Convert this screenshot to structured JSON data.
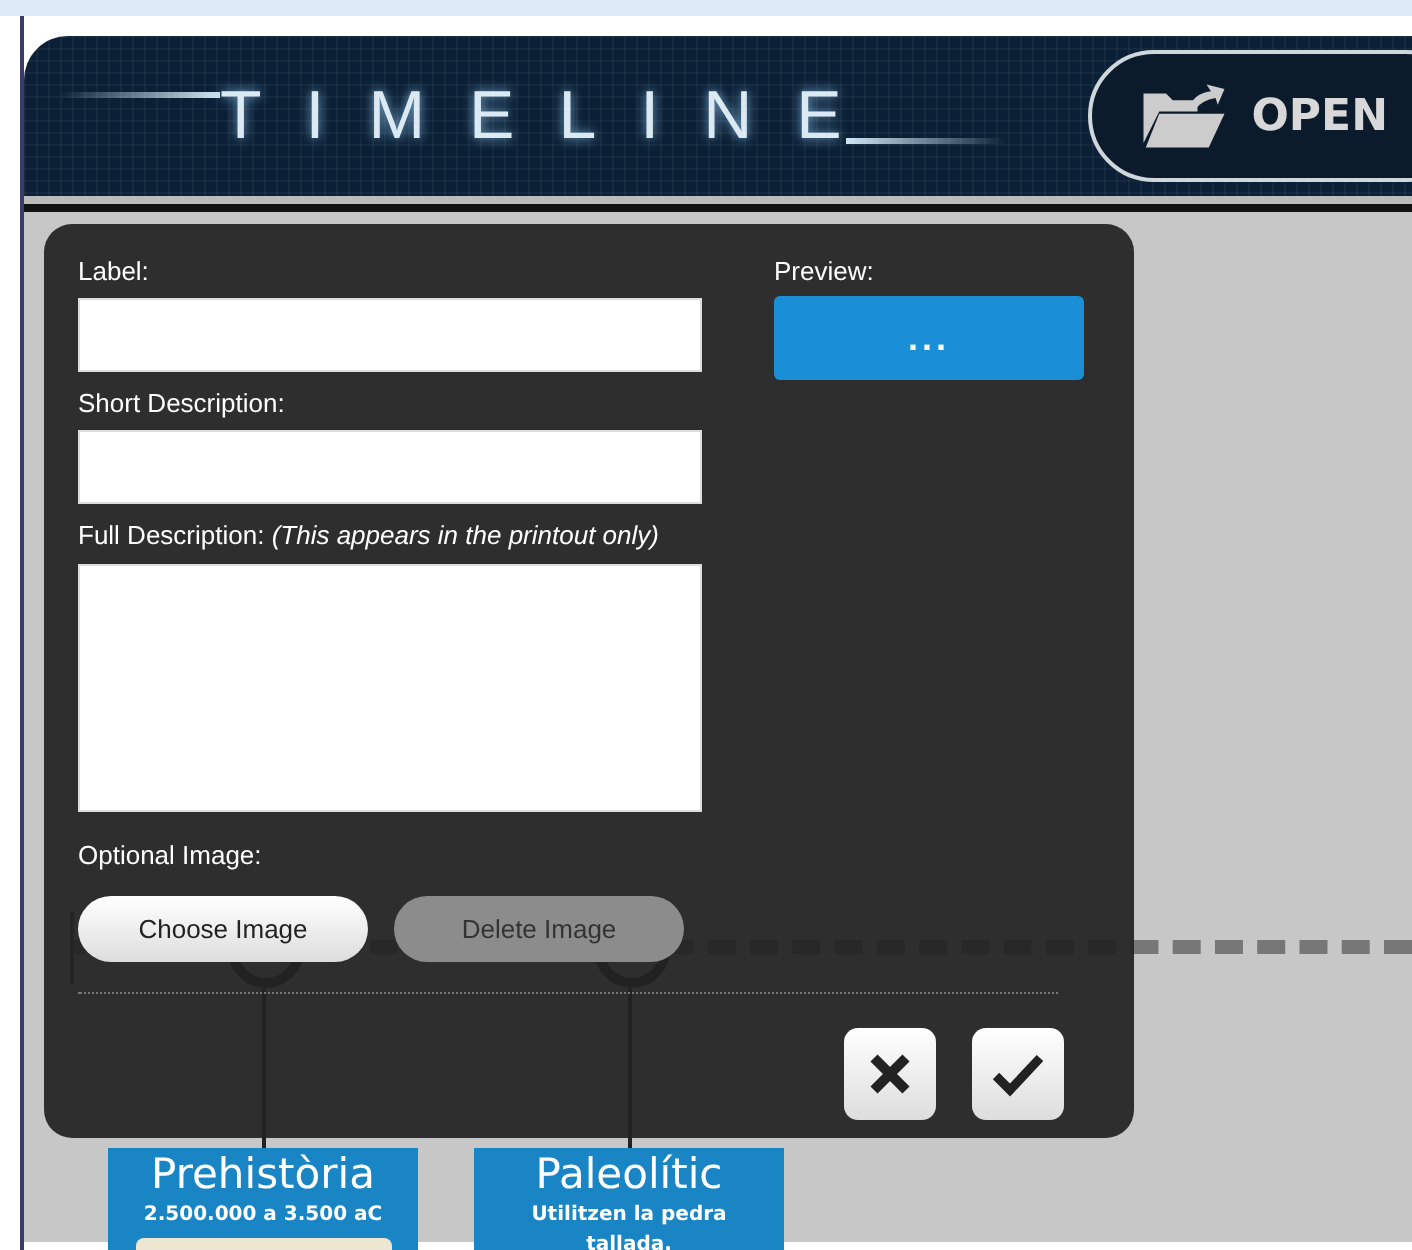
{
  "header": {
    "title": "TIMELINE",
    "open_button": "OPEN"
  },
  "events": [
    {
      "title": "Prehistòria",
      "subtitle": "2.500.000 a 3.500 aC"
    },
    {
      "title": "Paleolític",
      "subtitle": "Utilitzen la pedra tallada."
    }
  ],
  "dialog": {
    "fields": [
      {
        "label": "Label:",
        "kind": "input"
      },
      {
        "label": "Short Description:",
        "kind": "input"
      },
      {
        "label": "Full Description: *(This appears in the printout only)*",
        "kind": "textarea"
      }
    ],
    "image_label": "Optional Image:",
    "image_buttons": [
      {
        "label": "Choose Image",
        "disabled": false
      },
      {
        "label": "Delete Image",
        "disabled": true
      }
    ],
    "preview": {
      "label": "Preview:",
      "button": "..."
    }
  }
}
